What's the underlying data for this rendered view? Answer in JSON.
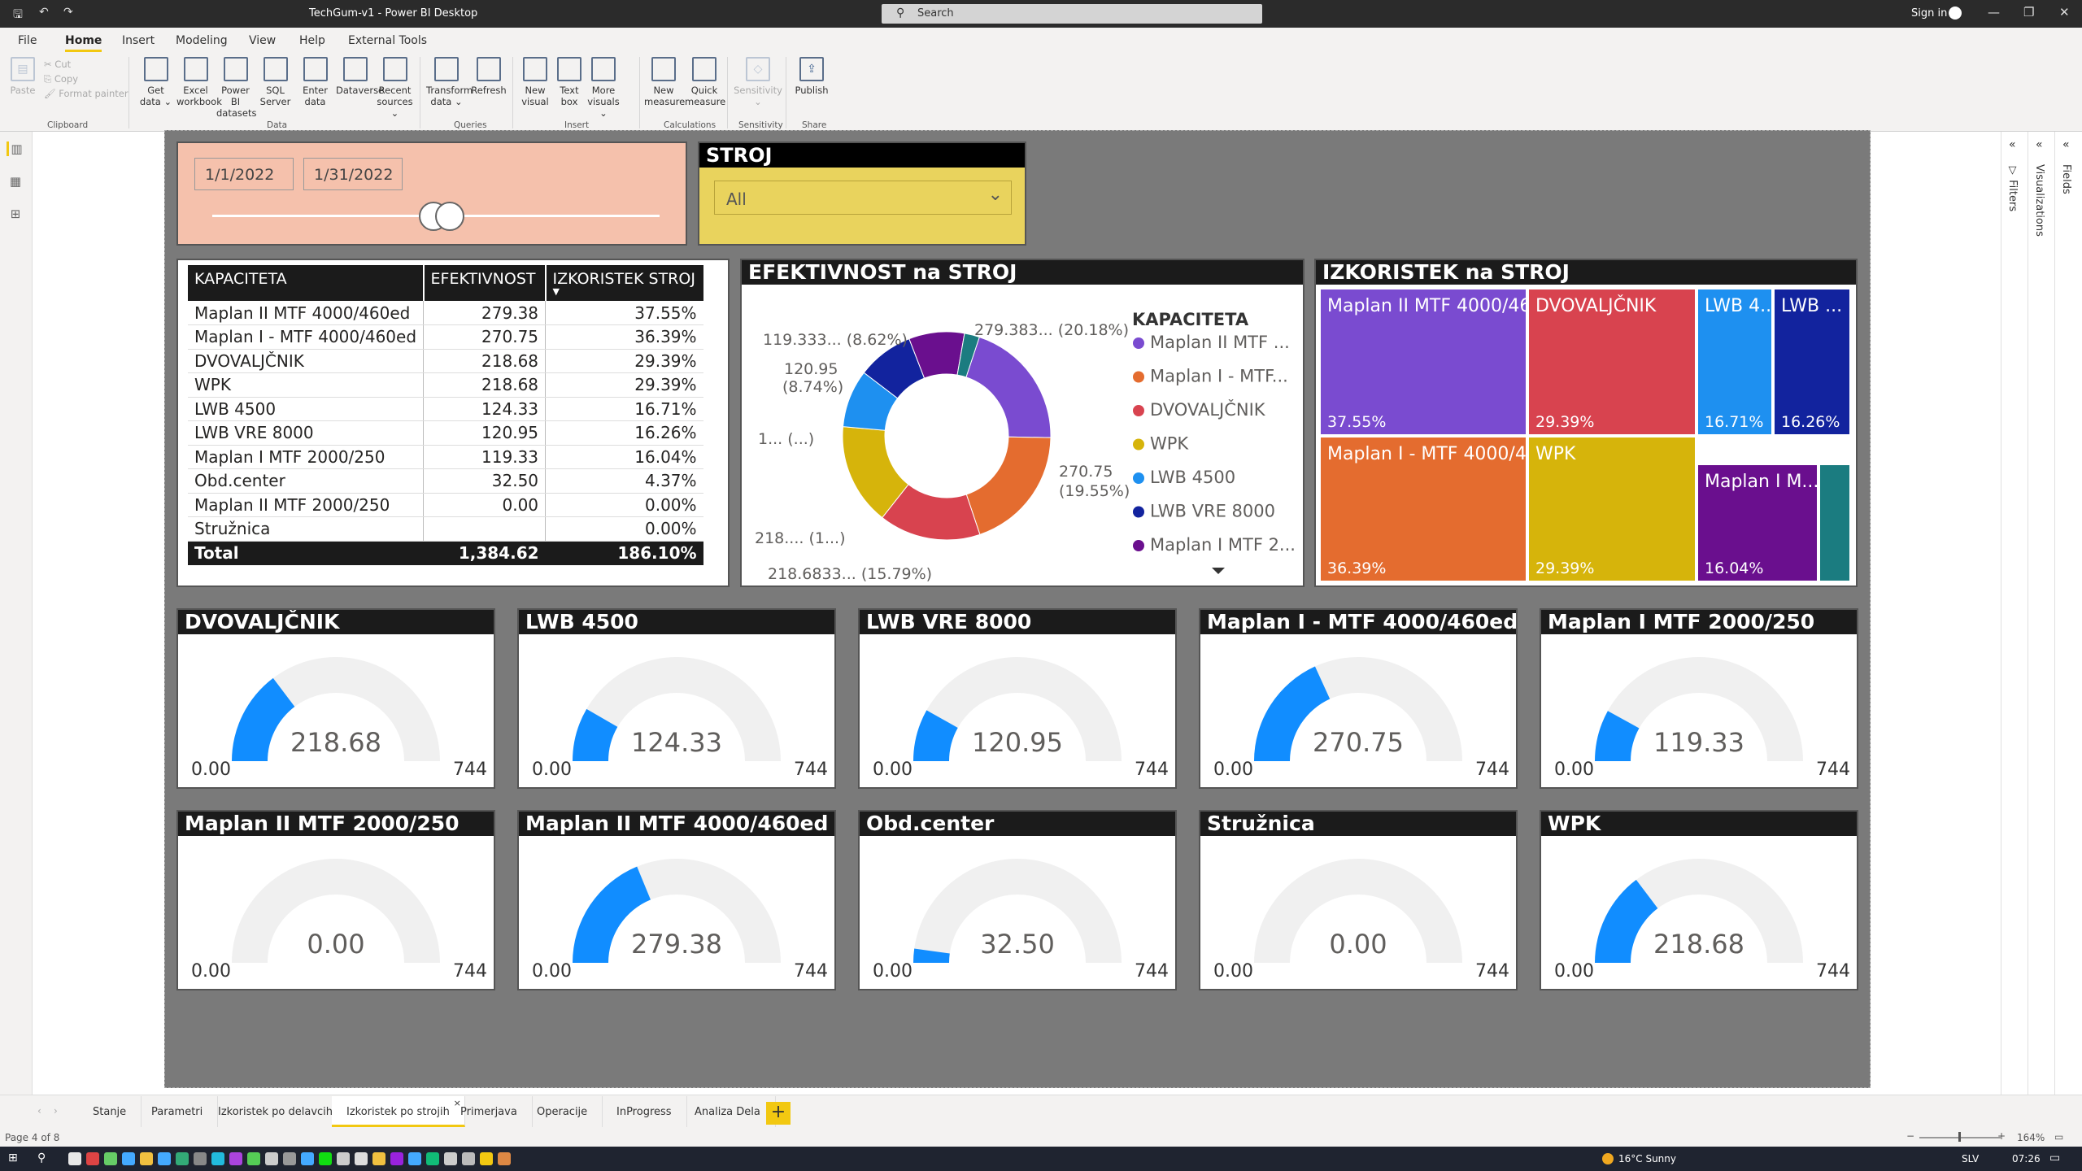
{
  "window": {
    "title": "TechGum-v1 - Power BI Desktop",
    "search_placeholder": "Search",
    "sign_in": "Sign in"
  },
  "menu": [
    "File",
    "Home",
    "Insert",
    "Modeling",
    "View",
    "Help",
    "External Tools"
  ],
  "ribbon": {
    "clipboard": {
      "paste": "Paste",
      "cut": "Cut",
      "copy": "Copy",
      "format_painter": "Format painter",
      "group": "Clipboard"
    },
    "data_buttons": [
      [
        "Get",
        "data ⌄"
      ],
      [
        "Excel",
        "workbook"
      ],
      [
        "Power BI",
        "datasets"
      ],
      [
        "SQL",
        "Server"
      ],
      [
        "Enter",
        "data"
      ],
      [
        "Dataverse",
        ""
      ],
      [
        "Recent",
        "sources ⌄"
      ]
    ],
    "data_group": "Data",
    "queries_buttons": [
      [
        "Transform",
        "data ⌄"
      ],
      [
        "Refresh",
        ""
      ]
    ],
    "queries_group": "Queries",
    "insert_buttons": [
      [
        "New",
        "visual"
      ],
      [
        "Text",
        "box"
      ],
      [
        "More",
        "visuals ⌄"
      ]
    ],
    "insert_group": "Insert",
    "calc_buttons": [
      [
        "New",
        "measure"
      ],
      [
        "Quick",
        "measure"
      ]
    ],
    "calc_group": "Calculations",
    "sensitivity_button": [
      "Sensitivity",
      "⌄"
    ],
    "sensitivity_group": "Sensitivity",
    "publish_button": "Publish",
    "share_group": "Share"
  },
  "date_slicer": {
    "start": "1/1/2022",
    "end": "1/31/2022"
  },
  "stroj_slicer": {
    "title": "STROJ",
    "value": "All"
  },
  "table": {
    "headers": [
      "KAPACITETA",
      "EFEKTIVNOST",
      "IZKORISTEK STROJ"
    ],
    "rows": [
      [
        "Maplan II MTF 4000/460ed",
        "279.38",
        "37.55%"
      ],
      [
        "Maplan I - MTF 4000/460ed",
        "270.75",
        "36.39%"
      ],
      [
        "DVOVALJČNIK",
        "218.68",
        "29.39%"
      ],
      [
        "WPK",
        "218.68",
        "29.39%"
      ],
      [
        "LWB 4500",
        "124.33",
        "16.71%"
      ],
      [
        "LWB VRE 8000",
        "120.95",
        "16.26%"
      ],
      [
        "Maplan I MTF 2000/250",
        "119.33",
        "16.04%"
      ],
      [
        "Obd.center",
        "32.50",
        "4.37%"
      ],
      [
        "Maplan II MTF 2000/250",
        "0.00",
        "0.00%"
      ],
      [
        "Stružnica",
        "",
        "0.00%"
      ]
    ],
    "total": [
      "Total",
      "1,384.62",
      "186.10%"
    ]
  },
  "donut": {
    "title": "EFEKTIVNOST na STROJ",
    "legend_title": "KAPACITETA",
    "legend": [
      "Maplan II MTF ...",
      "Maplan I - MTF...",
      "DVOVALJČNIK",
      "WPK",
      "LWB 4500",
      "LWB VRE 8000",
      "Maplan I MTF 2..."
    ],
    "callouts": [
      "279.383... (20.18%)",
      "270.75",
      "(19.55%)",
      "218.6833... (15.79%)",
      "218.... (1...)",
      "1... (...)",
      "120.95",
      "(8.74%)",
      "119.333... (8.62%)"
    ]
  },
  "treemap": {
    "title": "IZKORISTEK na STROJ",
    "tiles": [
      {
        "label": "Maplan II MTF 4000/46...",
        "value": "37.55%"
      },
      {
        "label": "DVOVALJČNIK",
        "value": "29.39%"
      },
      {
        "label": "LWB 4...",
        "value": "16.71%"
      },
      {
        "label": "LWB ...",
        "value": "16.26%"
      },
      {
        "label": "Maplan I - MTF 4000/4...",
        "value": "36.39%"
      },
      {
        "label": "WPK",
        "value": "29.39%"
      },
      {
        "label": "Maplan I M...",
        "value": "16.04%"
      },
      {
        "label": "",
        "value": ""
      }
    ]
  },
  "gauges": [
    {
      "title": "DVOVALJČNIK",
      "value": "218.68",
      "min": "0.00",
      "max": "744"
    },
    {
      "title": "LWB 4500",
      "value": "124.33",
      "min": "0.00",
      "max": "744"
    },
    {
      "title": "LWB VRE 8000",
      "value": "120.95",
      "min": "0.00",
      "max": "744"
    },
    {
      "title": "Maplan I - MTF 4000/460ed",
      "value": "270.75",
      "min": "0.00",
      "max": "744"
    },
    {
      "title": "Maplan I MTF 2000/250",
      "value": "119.33",
      "min": "0.00",
      "max": "744"
    },
    {
      "title": "Maplan II MTF 2000/250",
      "value": "0.00",
      "min": "0.00",
      "max": "744"
    },
    {
      "title": "Maplan II MTF 4000/460ed",
      "value": "279.38",
      "min": "0.00",
      "max": "744"
    },
    {
      "title": "Obd.center",
      "value": "32.50",
      "min": "0.00",
      "max": "744"
    },
    {
      "title": "Stružnica",
      "value": "0.00",
      "min": "0.00",
      "max": "744"
    },
    {
      "title": "WPK",
      "value": "218.68",
      "min": "0.00",
      "max": "744"
    }
  ],
  "panes": {
    "filters": "Filters",
    "visualizations": "Visualizations",
    "fields": "Fields"
  },
  "tabs": [
    "Stanje",
    "Parametri",
    "Izkoristek po delavcih",
    "Izkoristek po strojih",
    "Primerjava",
    "Operacije",
    "InProgress",
    "Analiza Dela"
  ],
  "active_tab": "Izkoristek po strojih",
  "status": {
    "page": "Page 4 of 8",
    "zoom": "164%"
  },
  "taskbar": {
    "weather": "16°C  Sunny",
    "lang": "SLV",
    "time": "07:26"
  },
  "colors": {
    "purple": "#7a4bd0",
    "orange": "#e46c2f",
    "red": "#d8434f",
    "yellow": "#d6b40b",
    "blue": "#1e90f0",
    "navy": "#12239e",
    "violet": "#6a0f8e",
    "teal": "#1b7c80",
    "gauge": "#118dff"
  }
}
